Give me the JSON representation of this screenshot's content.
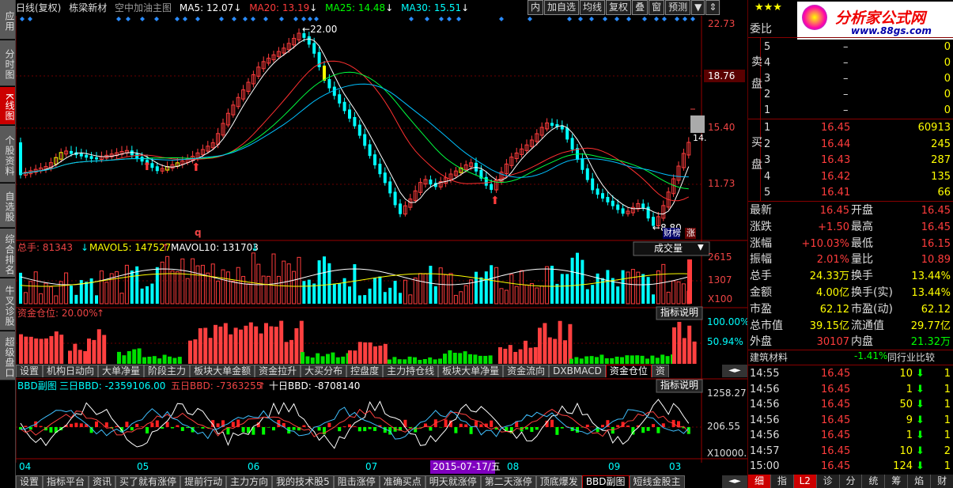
{
  "left_nav": [
    "应用",
    "分时图",
    "K线图",
    "个股资料",
    "自选股",
    "综合排名",
    "牛叉诊股",
    "超级盘口"
  ],
  "top": {
    "label1": "日线(复权)",
    "name": "栋梁新材",
    "overlay": "空中加油主图",
    "ma5": "MA5: 12.07",
    "ma20": "MA20: 13.19",
    "ma25": "MA25: 14.48",
    "ma30": "MA30: 15.51",
    "buttons": [
      "内",
      "加自选",
      "均线",
      "复权",
      "叠",
      "窗",
      "预测"
    ]
  },
  "price_axis": [
    "22.73",
    "18.76",
    "15.40",
    "11.73"
  ],
  "annot": {
    "high": "22.00",
    "low": "8.80",
    "cur": "14.",
    "mark_q": "q",
    "badge1": "财榜",
    "badge2": "涨"
  },
  "vol": {
    "label": "总手: 81343",
    "mavol5": "MAVOL5: 147527",
    "mavol10": "MAVOL10: 131703",
    "dropdown": "成交量",
    "axis": [
      "2615",
      "1307",
      "X100"
    ]
  },
  "fund": {
    "label": "资金仓位: 20.00%",
    "explain": "指标说明",
    "axis": [
      "100.00%",
      "50.94%"
    ]
  },
  "tabs1": [
    "设置",
    "机构日动向",
    "大单净量",
    "阶段主力",
    "板块大单金额",
    "资金拉升",
    "大买分布",
    "控盘度",
    "主力持仓线",
    "板块大单净量",
    "资金流向",
    "DXBMACD",
    "资金仓位",
    "资"
  ],
  "bbd": {
    "label": "BBD副图",
    "three": "三日BBD: -2359106.00",
    "five": "五日BBD: -7363255",
    "ten": "十日BBD: -8708140",
    "explain": "指标说明",
    "axis": [
      "1258.27",
      "206.55",
      "X10000.0"
    ]
  },
  "months": [
    "04",
    "05",
    "06",
    "07",
    "08",
    "09",
    "03"
  ],
  "date_marker": "2015-07-17/五",
  "tabs2": [
    "设置",
    "指标平台",
    "资讯",
    "买了就有涨停",
    "提前行动",
    "主力方向",
    "我的技术股5",
    "阻击涨停",
    "准确买点",
    "明天就涨停",
    "第二天涨停",
    "顶底爆发",
    "BBD副图",
    "短线金股主"
  ],
  "right": {
    "logo": "分析家公式网",
    "logo_url": "www.88gs.com",
    "stars": "★★★",
    "webi": "委比",
    "sell_label": "卖盘",
    "buy_label": "买盘",
    "sells": [
      {
        "n": "5",
        "p": "–",
        "v": "0"
      },
      {
        "n": "4",
        "p": "–",
        "v": "0"
      },
      {
        "n": "3",
        "p": "–",
        "v": "0"
      },
      {
        "n": "2",
        "p": "–",
        "v": "0"
      },
      {
        "n": "1",
        "p": "–",
        "v": "0"
      }
    ],
    "buys": [
      {
        "n": "1",
        "p": "16.45",
        "v": "60913"
      },
      {
        "n": "2",
        "p": "16.44",
        "v": "245"
      },
      {
        "n": "3",
        "p": "16.43",
        "v": "287"
      },
      {
        "n": "4",
        "p": "16.42",
        "v": "135"
      },
      {
        "n": "5",
        "p": "16.41",
        "v": "66"
      }
    ],
    "stats": [
      [
        "最新",
        "16.45",
        "开盘",
        "16.45"
      ],
      [
        "涨跌",
        "+1.50",
        "最高",
        "16.45"
      ],
      [
        "涨幅",
        "+10.03%",
        "最低",
        "16.15"
      ],
      [
        "振幅",
        "2.01%",
        "量比",
        "10.89"
      ],
      [
        "总手",
        "24.33万",
        "换手",
        "13.44%"
      ],
      [
        "金额",
        "4.00亿",
        "换手(实)",
        "13.44%"
      ],
      [
        "市盈",
        "62.12",
        "市盈(动)",
        "62.12"
      ],
      [
        "总市值",
        "39.15亿",
        "流通值",
        "29.77亿"
      ],
      [
        "外盘",
        "30107",
        "内盘",
        "21.32万"
      ]
    ],
    "sector": "建筑材料",
    "sector_chg": "-1.41%",
    "compare": "同行业比较",
    "ticks": [
      [
        "14:55",
        "16.45",
        "10",
        "1"
      ],
      [
        "14:56",
        "16.45",
        "1",
        "1"
      ],
      [
        "14:56",
        "16.45",
        "50",
        "1"
      ],
      [
        "14:56",
        "16.45",
        "9",
        "1"
      ],
      [
        "14:56",
        "16.45",
        "1",
        "1"
      ],
      [
        "14:57",
        "16.45",
        "10",
        "2"
      ],
      [
        "15:00",
        "16.45",
        "124",
        "1"
      ]
    ],
    "bottom_tabs": [
      "细",
      "指",
      "L2",
      "诊",
      "分",
      "统",
      "筹",
      "焰",
      "财"
    ]
  },
  "colors": {
    "up": "#ff3c3c",
    "down": "#00ffff",
    "bg": "#000000",
    "grid": "#6a0000",
    "ma5": "#ffffff",
    "ma20": "#ff3030",
    "ma25": "#00ff40",
    "ma30": "#00c0ff"
  }
}
